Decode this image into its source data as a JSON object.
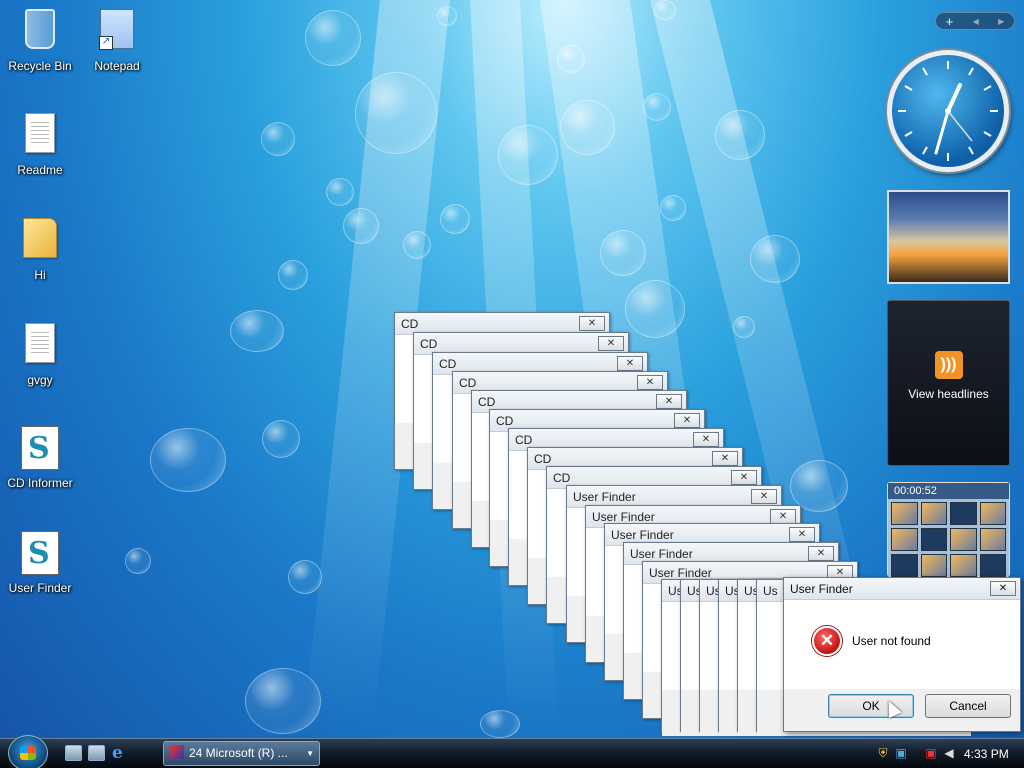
{
  "desktop": {
    "icons": [
      {
        "label": "Recycle Bin",
        "icon": "recycle-bin-icon"
      },
      {
        "label": "Notepad",
        "icon": "notepad-icon"
      },
      {
        "label": "Readme",
        "icon": "text-document-icon"
      },
      {
        "label": "Hi",
        "icon": "folder-icon"
      },
      {
        "label": "gvgy",
        "icon": "text-document-icon"
      },
      {
        "label": "CD Informer",
        "icon": "setup-icon"
      },
      {
        "label": "User Finder",
        "icon": "setup-icon"
      }
    ]
  },
  "sidebar": {
    "add_gadget": "+",
    "prev": "◀",
    "next": "▶",
    "feed_label": "View headlines",
    "puzzle_timer": "00:00:52",
    "clock_time": "4:33"
  },
  "stacked_windows": [
    {
      "title": "CD"
    },
    {
      "title": "CD"
    },
    {
      "title": "CD"
    },
    {
      "title": "CD"
    },
    {
      "title": "CD"
    },
    {
      "title": "CD"
    },
    {
      "title": "CD"
    },
    {
      "title": "CD"
    },
    {
      "title": "CD"
    },
    {
      "title": "User Finder"
    },
    {
      "title": "User Finder"
    },
    {
      "title": "User Finder"
    },
    {
      "title": "User Finder"
    },
    {
      "title": "User Finder"
    },
    {
      "title": "Us"
    },
    {
      "title": "Us"
    },
    {
      "title": "Us"
    },
    {
      "title": "Us"
    },
    {
      "title": "Us"
    },
    {
      "title": "Us"
    }
  ],
  "dialog": {
    "title": "User Finder",
    "message": "User not found",
    "ok_label": "OK",
    "cancel_label": "Cancel",
    "close_glyph": "✕"
  },
  "taskbar": {
    "task_label": "24 Microsoft (R) ...",
    "time": "4:33 PM"
  }
}
